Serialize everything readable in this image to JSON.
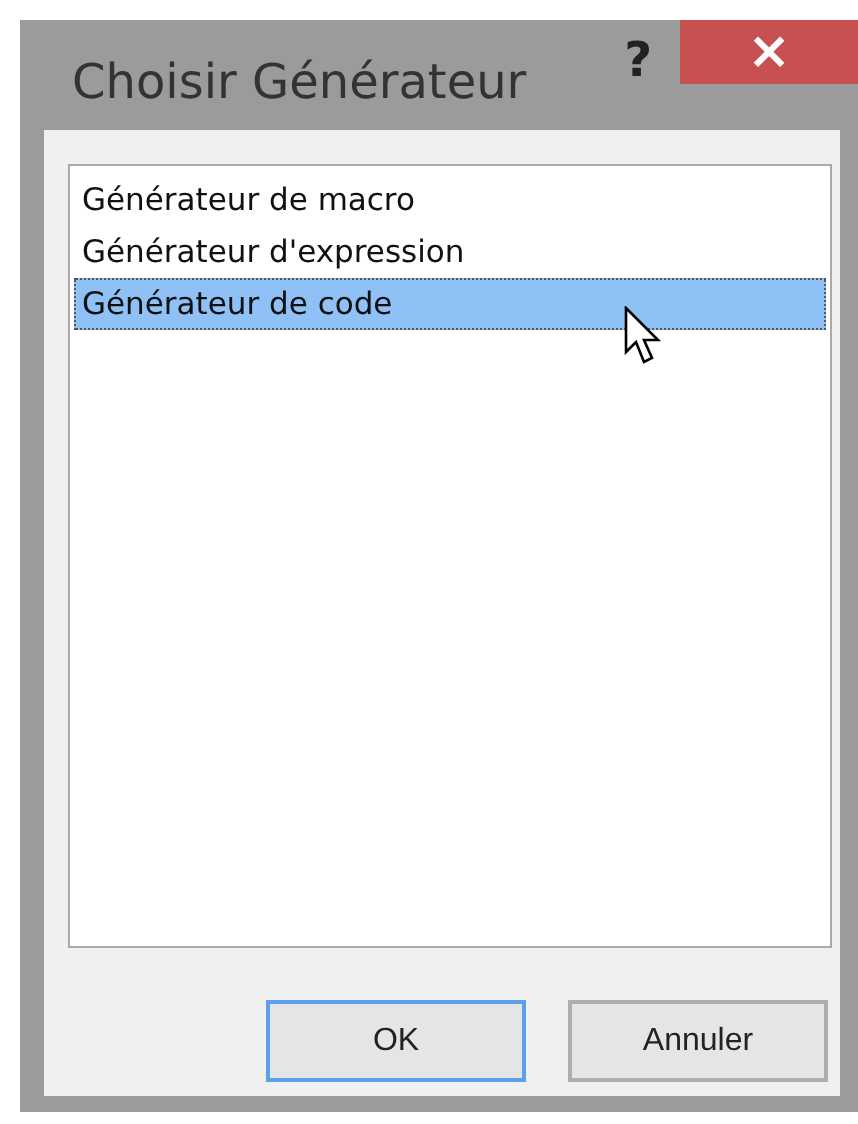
{
  "window": {
    "title": "Choisir Générateur",
    "help": "?",
    "close": "×"
  },
  "list": [
    {
      "label": "Générateur de macro",
      "selected": false
    },
    {
      "label": "Générateur d'expression",
      "selected": false
    },
    {
      "label": "Générateur de code",
      "selected": true
    }
  ],
  "buttons": [
    {
      "label": "OK",
      "default": true
    },
    {
      "label": "Annuler",
      "default": false
    }
  ]
}
